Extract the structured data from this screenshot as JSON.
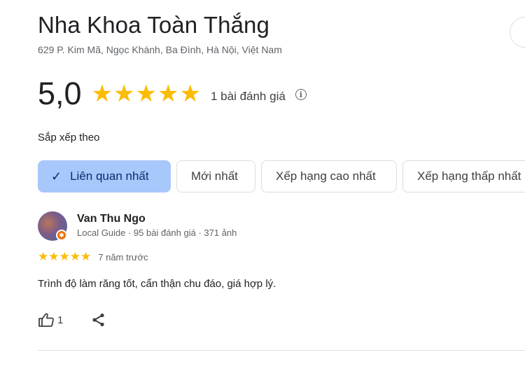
{
  "place": {
    "name": "Nha Khoa Toàn Thắng",
    "address": "629 P. Kim Mã, Ngọc Khánh, Ba Đình, Hà Nội, Việt Nam"
  },
  "rating": {
    "value": "5,0",
    "stars": 5,
    "review_count": "1 bài đánh giá",
    "info_icon": "info-icon"
  },
  "sort": {
    "label": "Sắp xếp theo",
    "chips": [
      {
        "label": "Liên quan nhất",
        "selected": true
      },
      {
        "label": "Mới nhất",
        "selected": false
      },
      {
        "label": "Xếp hạng cao nhất",
        "selected": false
      },
      {
        "label": "Xếp hạng thấp nhất",
        "selected": false
      }
    ]
  },
  "review": {
    "author": "Van Thu Ngo",
    "meta": "Local Guide · 95 bài đánh giá · 371 ảnh",
    "stars": 5,
    "time": "7 năm trước",
    "text": "Trình độ làm răng tốt, cẩn thận chu đáo, giá hợp lý.",
    "likes": "1"
  },
  "colors": {
    "star": "#fbbc04",
    "chip_selected_bg": "#a8c7fa",
    "chip_selected_text": "#062e6f",
    "local_guide_badge": "#e8710a"
  }
}
